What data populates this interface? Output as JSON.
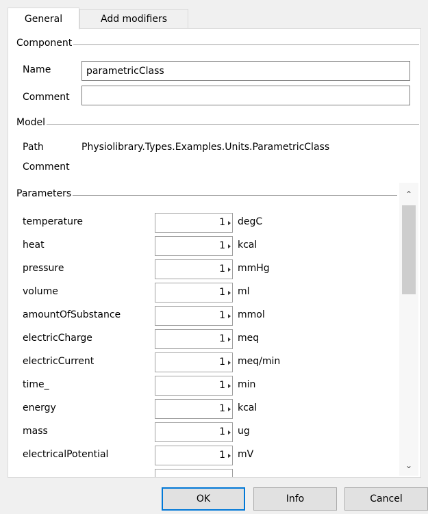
{
  "tabs": [
    {
      "label": "General"
    },
    {
      "label": "Add modifiers"
    }
  ],
  "component": {
    "heading": "Component",
    "name_label": "Name",
    "name_value": "parametricClass",
    "comment_label": "Comment",
    "comment_value": ""
  },
  "model": {
    "heading": "Model",
    "path_label": "Path",
    "path_value": "Physiolibrary.Types.Examples.Units.ParametricClass",
    "comment_label": "Comment"
  },
  "parameters": {
    "heading": "Parameters",
    "rows": [
      {
        "name": "temperature",
        "value": "1",
        "unit": "degC"
      },
      {
        "name": "heat",
        "value": "1",
        "unit": "kcal"
      },
      {
        "name": "pressure",
        "value": "1",
        "unit": "mmHg"
      },
      {
        "name": "volume",
        "value": "1",
        "unit": "ml"
      },
      {
        "name": "amountOfSubstance",
        "value": "1",
        "unit": "mmol"
      },
      {
        "name": "electricCharge",
        "value": "1",
        "unit": "meq"
      },
      {
        "name": "electricCurrent",
        "value": "1",
        "unit": "meq/min"
      },
      {
        "name": "time_",
        "value": "1",
        "unit": "min"
      },
      {
        "name": "energy",
        "value": "1",
        "unit": "kcal"
      },
      {
        "name": "mass",
        "value": "1",
        "unit": "ug"
      },
      {
        "name": "electricalPotential",
        "value": "1",
        "unit": "mV"
      }
    ]
  },
  "buttons": {
    "ok": "OK",
    "info": "Info",
    "cancel": "Cancel"
  },
  "colors": {
    "default_button_border": "#0078d7",
    "panel_background": "#ffffff",
    "window_background": "#f0f0f0"
  }
}
